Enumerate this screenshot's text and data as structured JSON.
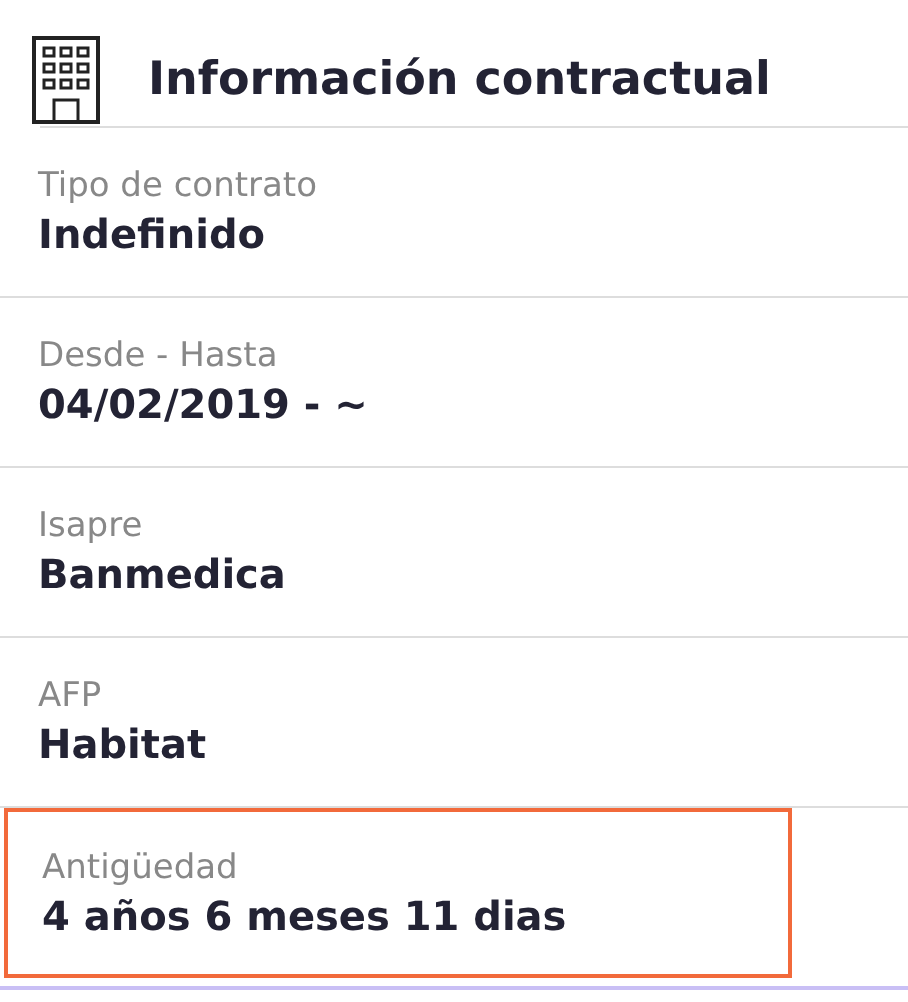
{
  "title": "Información contractual",
  "fields": [
    {
      "label": "Tipo de contrato",
      "value": "Indefinido",
      "highlighted": false
    },
    {
      "label": "Desde - Hasta",
      "value": "04/02/2019 - ~",
      "highlighted": false
    },
    {
      "label": "Isapre",
      "value": "Banmedica",
      "highlighted": false
    },
    {
      "label": "AFP",
      "value": "Habitat",
      "highlighted": false
    },
    {
      "label": "Antigüedad",
      "value": "4 años 6 meses 11 dias",
      "highlighted": true
    }
  ]
}
